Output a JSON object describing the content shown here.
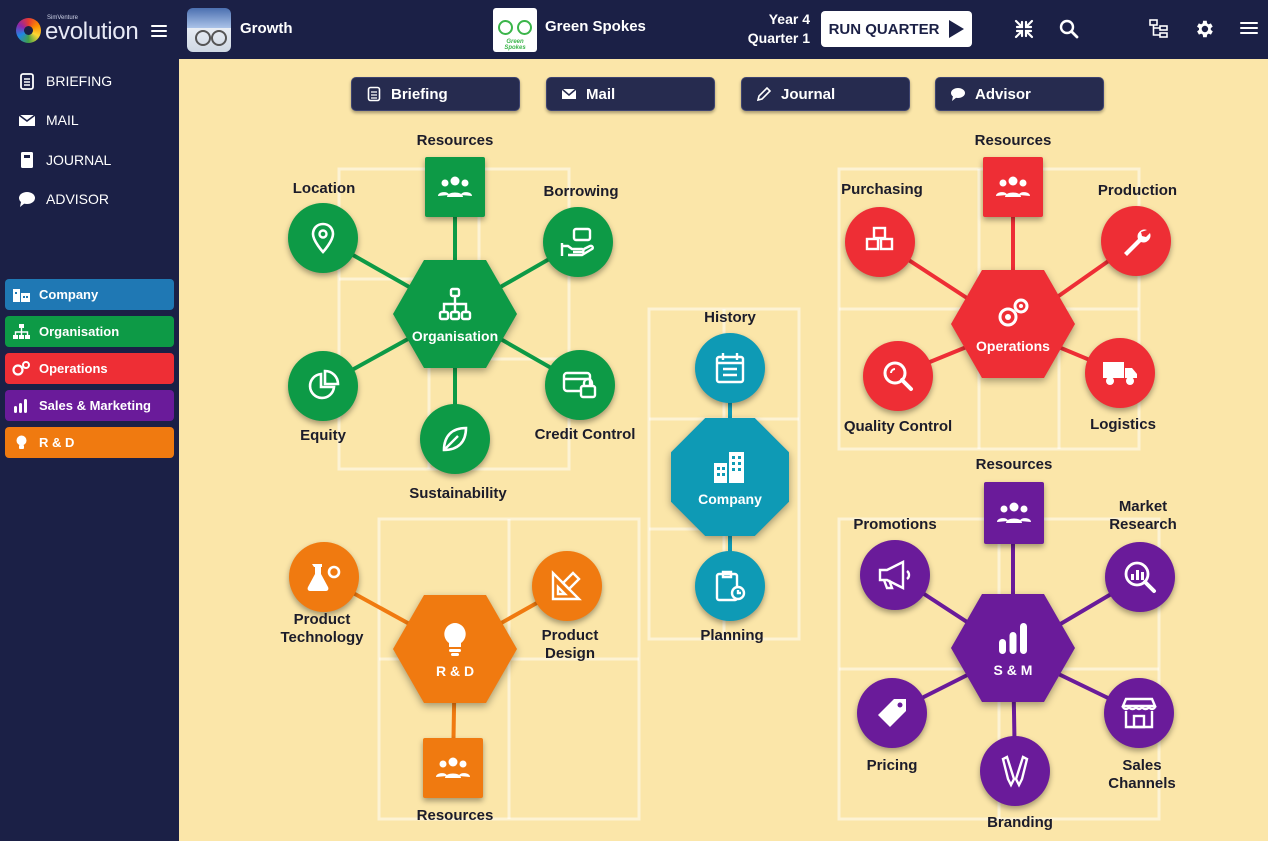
{
  "header": {
    "logo_small": "SimVenture",
    "logo_text": "evolution",
    "scenario_name": "Growth",
    "company_logo_text": "Green Spokes",
    "company_name": "Green Spokes",
    "year": "Year 4",
    "quarter": "Quarter 1",
    "run_button": "RUN QUARTER"
  },
  "sidebar": {
    "nav": [
      {
        "label": "BRIEFING",
        "icon": "clipboard-icon"
      },
      {
        "label": "MAIL",
        "icon": "envelope-icon"
      },
      {
        "label": "JOURNAL",
        "icon": "notebook-icon"
      },
      {
        "label": "ADVISOR",
        "icon": "chat-bubble-icon"
      }
    ],
    "departments": [
      {
        "label": "Company",
        "color": "#1f78b4",
        "icon": "buildings-icon"
      },
      {
        "label": "Organisation",
        "color": "#0d9a46",
        "icon": "org-chart-icon"
      },
      {
        "label": "Operations",
        "color": "#ee2e35",
        "icon": "gears-icon"
      },
      {
        "label": "Sales & Marketing",
        "color": "#6a1b9a",
        "icon": "bar-chart-icon"
      },
      {
        "label": "R & D",
        "color": "#f07a10",
        "icon": "lightbulb-icon"
      }
    ]
  },
  "tabs": [
    {
      "label": "Briefing",
      "icon": "clipboard-icon"
    },
    {
      "label": "Mail",
      "icon": "envelope-icon"
    },
    {
      "label": "Journal",
      "icon": "pencil-icon"
    },
    {
      "label": "Advisor",
      "icon": "chat-bubble-icon"
    }
  ],
  "colors": {
    "organisation": "#0d9a46",
    "operations": "#ee2e35",
    "company": "#0e9ab5",
    "sales_marketing": "#6a1b9a",
    "rnd": "#f07a10",
    "background": "#fbe6a9",
    "header": "#1b2046"
  },
  "clusters": {
    "organisation": {
      "hub": "Organisation",
      "nodes": [
        "Resources",
        "Location",
        "Borrowing",
        "Equity",
        "Credit Control",
        "Sustainability"
      ]
    },
    "operations": {
      "hub": "Operations",
      "nodes": [
        "Resources",
        "Purchasing",
        "Production",
        "Quality Control",
        "Logistics"
      ]
    },
    "company": {
      "hub": "Company",
      "nodes": [
        "History",
        "Planning"
      ]
    },
    "rnd": {
      "hub": "R & D",
      "nodes": [
        "Product Technology",
        "Product Design",
        "Resources"
      ]
    },
    "sales_marketing": {
      "hub": "S & M",
      "nodes": [
        "Resources",
        "Promotions",
        "Market Research",
        "Pricing",
        "Sales Channels",
        "Branding"
      ]
    }
  }
}
